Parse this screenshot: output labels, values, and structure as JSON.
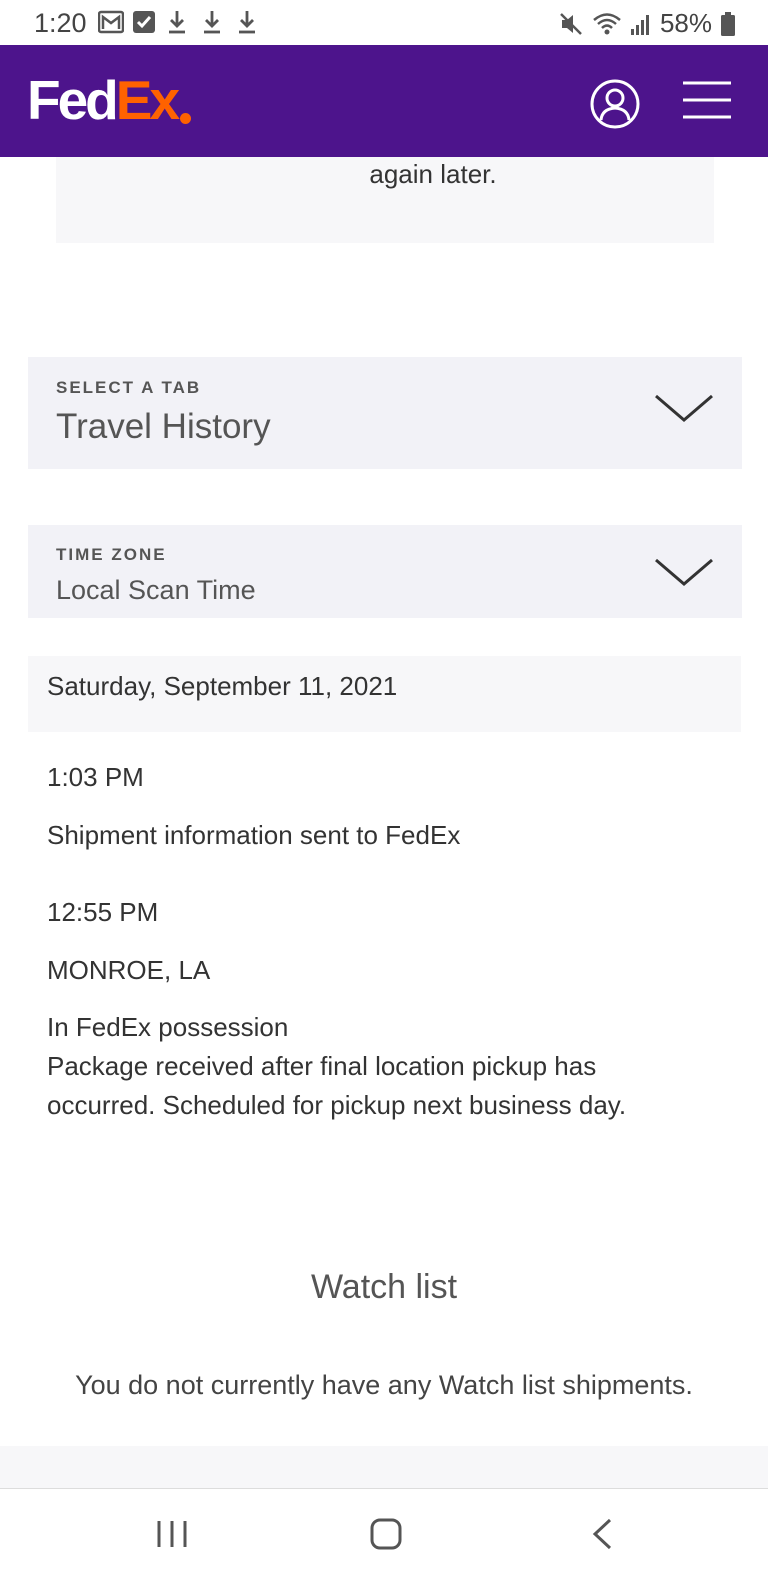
{
  "status_bar": {
    "time": "1:20",
    "battery": "58%",
    "icons": [
      "gmail-icon",
      "checkbox-icon",
      "download-icon",
      "download-icon",
      "download-icon",
      "mute-icon",
      "wifi-icon",
      "signal-icon",
      "battery-icon"
    ]
  },
  "header": {
    "logo_fed": "Fed",
    "logo_ex": "Ex",
    "brand_purple": "#4d148c",
    "brand_orange": "#ff6200"
  },
  "notice": {
    "text": "again later."
  },
  "tab_select": {
    "label": "SELECT A TAB",
    "value": "Travel History"
  },
  "timezone_select": {
    "label": "TIME ZONE",
    "value": "Local Scan Time"
  },
  "travel_history": {
    "date": "Saturday, September 11, 2021",
    "events": [
      {
        "time": "1:03 PM",
        "description": "Shipment information sent to FedEx"
      },
      {
        "time": "12:55 PM",
        "location": "MONROE, LA",
        "status": "In FedEx possession",
        "detail": "Package received after final location pickup has occurred. Scheduled for pickup next business day."
      }
    ]
  },
  "watch_list": {
    "title": "Watch list",
    "message": "You do not currently have any Watch list shipments."
  }
}
